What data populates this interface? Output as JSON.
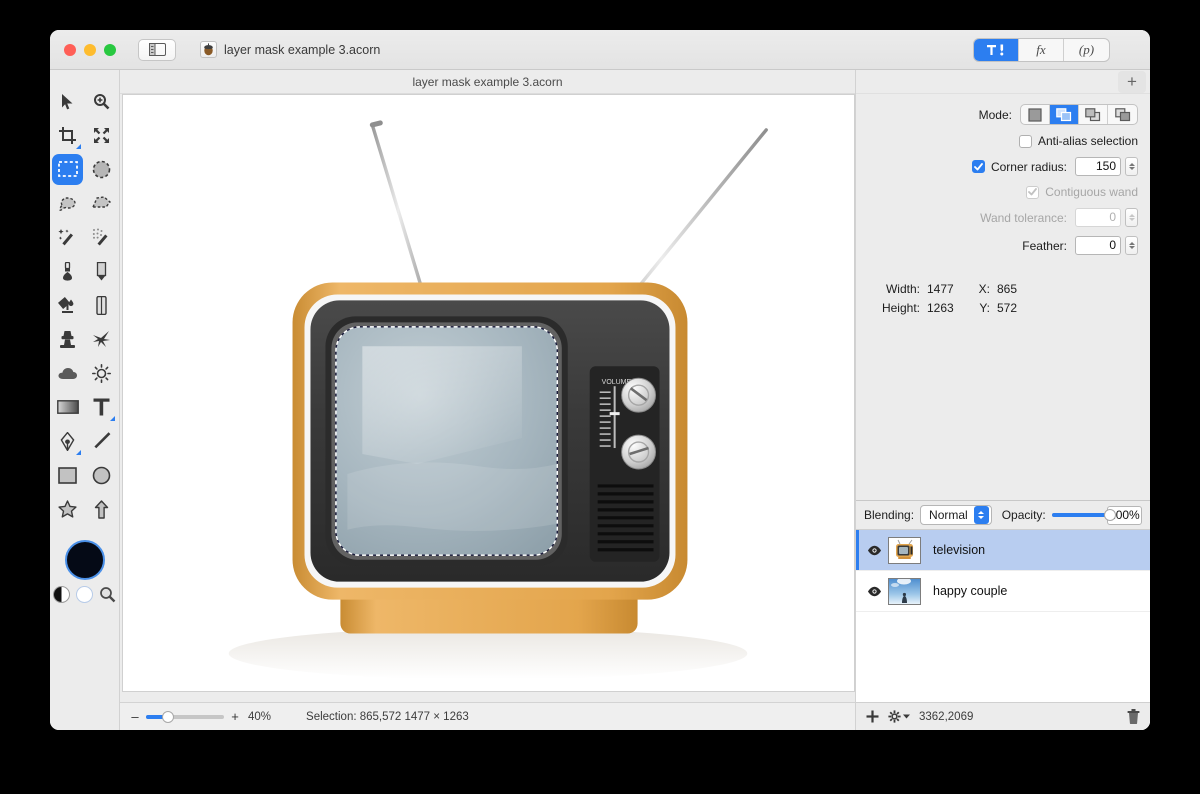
{
  "window": {
    "title": "layer mask example 3.acorn",
    "doc_icon": "acorn-document-icon",
    "traffic_lights": [
      "close",
      "minimize",
      "zoom"
    ],
    "sidebar_toggle_icon": "sidebar-toggle-icon"
  },
  "toolbar": {
    "segments": [
      {
        "name": "tools-inspector",
        "label": "",
        "icon": "tools-icon",
        "active": true
      },
      {
        "name": "filters-inspector",
        "label": "fx",
        "icon": "fx-icon",
        "active": false
      },
      {
        "name": "palette-inspector",
        "label": "(p)",
        "icon": "palette-icon",
        "active": false
      }
    ]
  },
  "tools": {
    "items": [
      {
        "name": "move-tool",
        "icon": "arrow-cursor-icon",
        "selected": false
      },
      {
        "name": "zoom-tool",
        "icon": "magnifier-plus-icon",
        "selected": false
      },
      {
        "name": "crop-tool",
        "icon": "crop-icon",
        "selected": false
      },
      {
        "name": "transform-tool",
        "icon": "move-arrows-icon",
        "selected": false
      },
      {
        "name": "rectangular-selection-tool",
        "icon": "rect-marquee-icon",
        "selected": true
      },
      {
        "name": "elliptical-selection-tool",
        "icon": "ellipse-marquee-icon",
        "selected": false
      },
      {
        "name": "lasso-tool",
        "icon": "lasso-icon",
        "selected": false
      },
      {
        "name": "polygon-lasso-tool",
        "icon": "polygon-lasso-icon",
        "selected": false
      },
      {
        "name": "magic-wand-tool",
        "icon": "magic-wand-icon",
        "selected": false
      },
      {
        "name": "instant-alpha-tool",
        "icon": "sparkle-wand-icon",
        "selected": false
      },
      {
        "name": "brush-tool",
        "icon": "brush-icon",
        "selected": false
      },
      {
        "name": "pencil-tool",
        "icon": "pencil-icon",
        "selected": false
      },
      {
        "name": "paint-bucket-tool",
        "icon": "paint-bucket-icon",
        "selected": false
      },
      {
        "name": "eraser-tool",
        "icon": "eraser-icon",
        "selected": false
      },
      {
        "name": "clone-stamp-tool",
        "icon": "clone-stamp-icon",
        "selected": false
      },
      {
        "name": "smudge-tool",
        "icon": "smudge-icon",
        "selected": false
      },
      {
        "name": "blur-tool",
        "icon": "cloud-blur-icon",
        "selected": false
      },
      {
        "name": "dodge-tool",
        "icon": "dodge-sun-icon",
        "selected": false
      },
      {
        "name": "gradient-tool",
        "icon": "gradient-icon",
        "selected": false
      },
      {
        "name": "text-tool",
        "icon": "text-t-icon",
        "selected": false
      },
      {
        "name": "bezier-pen-tool",
        "icon": "pen-nib-icon",
        "selected": false
      },
      {
        "name": "line-tool",
        "icon": "line-icon",
        "selected": false
      },
      {
        "name": "rectangle-shape-tool",
        "icon": "square-shape-icon",
        "selected": false
      },
      {
        "name": "ellipse-shape-tool",
        "icon": "circle-shape-icon",
        "selected": false
      },
      {
        "name": "star-shape-tool",
        "icon": "star-shape-icon",
        "selected": false
      },
      {
        "name": "arrow-shape-tool",
        "icon": "arrow-shape-icon",
        "selected": false
      }
    ],
    "color_well": {
      "name": "foreground-color-well",
      "color": "#050a16",
      "swap_icon": "half-circle-icon",
      "clear_icon": "empty-circle-icon",
      "picker_icon": "color-picker-magnifier-icon"
    }
  },
  "document": {
    "tab_title": "layer mask example 3.acorn",
    "canvas_background": "#ffffff"
  },
  "inspector": {
    "add_button_label": "+",
    "mode": {
      "label": "Mode:",
      "options": [
        {
          "name": "mode-new-selection",
          "icon": "new-selection-icon",
          "active": false
        },
        {
          "name": "mode-add-selection",
          "icon": "add-selection-icon",
          "active": true
        },
        {
          "name": "mode-subtract-selection",
          "icon": "subtract-selection-icon",
          "active": false
        },
        {
          "name": "mode-intersect-selection",
          "icon": "intersect-selection-icon",
          "active": false
        }
      ]
    },
    "anti_alias": {
      "label": "Anti-alias selection",
      "checked": false,
      "enabled": true
    },
    "corner_radius": {
      "label": "Corner radius:",
      "checked": true,
      "enabled": true,
      "value": "150"
    },
    "contiguous_wand": {
      "label": "Contiguous wand",
      "checked": true,
      "enabled": false
    },
    "wand_tolerance": {
      "label": "Wand tolerance:",
      "enabled": false,
      "value": "0"
    },
    "feather": {
      "label": "Feather:",
      "enabled": true,
      "value": "0"
    },
    "dimensions": {
      "width_label": "Width:",
      "width_value": "1477",
      "height_label": "Height:",
      "height_value": "1263",
      "x_label": "X:",
      "x_value": "865",
      "y_label": "Y:",
      "y_value": "572"
    }
  },
  "layers": {
    "blending_label": "Blending:",
    "blending_value": "Normal",
    "opacity_label": "Opacity:",
    "opacity_value": "100%",
    "opacity_percent": 100,
    "items": [
      {
        "name": "television",
        "thumb": "television-thumbnail",
        "visible": true,
        "selected": true
      },
      {
        "name": "happy couple",
        "thumb": "happy-couple-thumbnail",
        "visible": true,
        "selected": false
      }
    ],
    "footer": {
      "add_icon": "plus-icon",
      "settings_icon": "gear-dropdown-icon",
      "coordinates": "3362,2069",
      "delete_icon": "trash-icon"
    }
  },
  "statusbar": {
    "zoom_minus": "–",
    "zoom_plus": "+",
    "zoom_level": "40%",
    "zoom_percent": 40,
    "selection_text": "Selection: 865,572 1477 × 1263"
  },
  "colors": {
    "accent": "#2c7ef0",
    "window_chrome": "#ececec",
    "tv_body": "#e0a44a",
    "tv_bezel": "#3a3a3a",
    "tv_screen": "#9fb0b8"
  }
}
